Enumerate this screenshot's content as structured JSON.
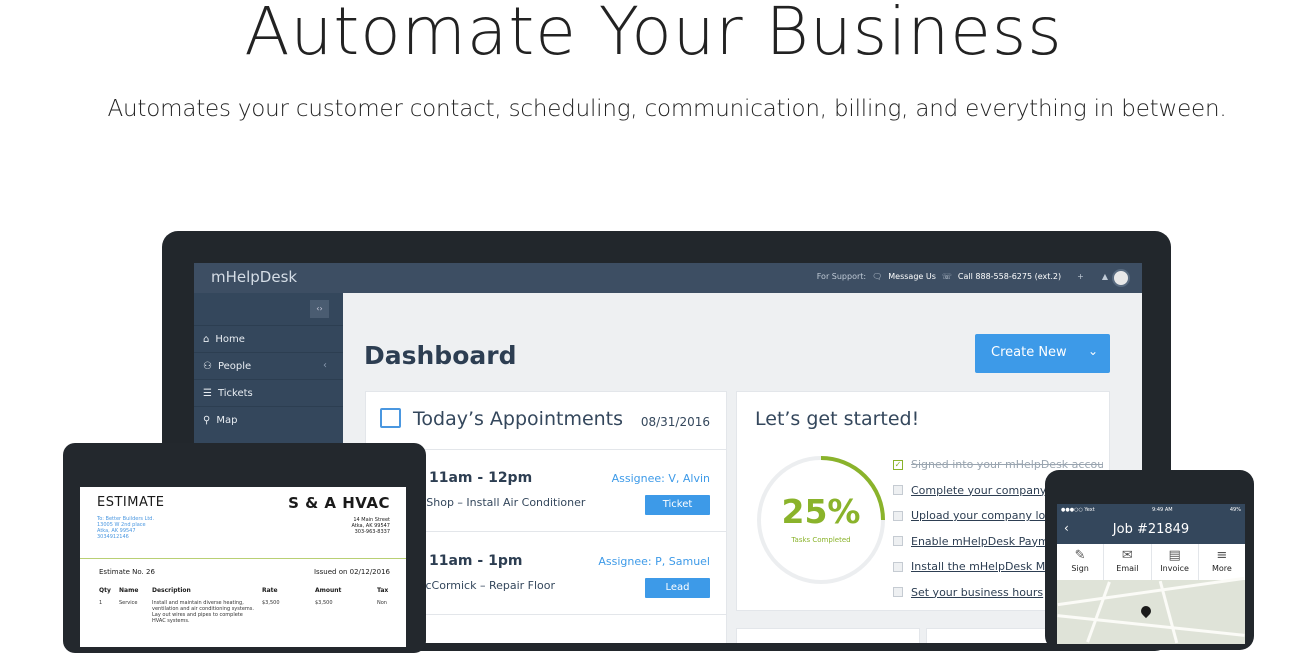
{
  "hero": {
    "title": "Automate Your Business",
    "subtitle": "Automates your customer contact, scheduling, communication, billing, and everything in between."
  },
  "app": {
    "brand": "mHelpDesk",
    "support": {
      "label": "For Support:",
      "message": "Message Us",
      "call": "Call 888-558-6275 (ext.2)"
    },
    "sidebar": {
      "items": [
        {
          "label": "Home",
          "icon": "home-icon"
        },
        {
          "label": "People",
          "icon": "people-icon"
        },
        {
          "label": "Tickets",
          "icon": "list-icon"
        },
        {
          "label": "Map",
          "icon": "map-pin-icon"
        }
      ]
    },
    "main": {
      "title": "Dashboard",
      "create_button": "Create New"
    },
    "appointments": {
      "title": "Today’s Appointments",
      "date": "08/31/2016",
      "rows": [
        {
          "time": "11am - 12pm",
          "assignee": "Assignee: V, Alvin",
          "desc": "e Shop – Install Air Conditioner",
          "tag": "Ticket"
        },
        {
          "time": "11am - 1pm",
          "assignee": "Assignee: P, Samuel",
          "desc": "McCormick – Repair Floor",
          "tag": "Lead"
        }
      ]
    },
    "getting_started": {
      "title": "Let’s get started!",
      "percent": "25%",
      "percent_value": 0.25,
      "percent_label": "Tasks Completed",
      "tasks": [
        {
          "label": "Signed into your mHelpDesk account",
          "done": true
        },
        {
          "label": "Complete your company pr",
          "done": false
        },
        {
          "label": "Upload your company logo",
          "done": false
        },
        {
          "label": "Enable mHelpDesk Paymen",
          "done": false
        },
        {
          "label": "Install the mHelpDesk Mob",
          "done": false
        },
        {
          "label": "Set your business hours",
          "done": false
        }
      ]
    }
  },
  "estimate": {
    "heading": "ESTIMATE",
    "company": "S & A HVAC",
    "to_lines": [
      "To: Better Builders Ltd.",
      "13005 W 2nd place",
      "Atka, AK 99547",
      "3034912146"
    ],
    "from_lines": [
      "14 Main Street",
      "Atka, AK 99547",
      "303-963-8337"
    ],
    "number": "Estimate No. 26",
    "issued": "Issued on 02/12/2016",
    "columns": [
      "Qty",
      "Name",
      "Description",
      "Rate",
      "Amount",
      "Tax"
    ],
    "row": {
      "qty": "1",
      "name": "Service",
      "description": "Install and maintain diverse heating, ventilation and air conditioning systems. Lay out wires and pipes to complete HVAC systems.",
      "rate": "$3,500",
      "amount": "$3,500",
      "tax": "Non"
    }
  },
  "phone": {
    "status_left": "●●●○○ Yext",
    "status_time": "9:49 AM",
    "status_right": "49%",
    "title": "Job #21849",
    "actions": [
      {
        "label": "Sign",
        "icon": "pen-icon"
      },
      {
        "label": "Email",
        "icon": "envelope-icon"
      },
      {
        "label": "Invoice",
        "icon": "document-icon"
      },
      {
        "label": "More",
        "icon": "menu-icon"
      }
    ]
  }
}
